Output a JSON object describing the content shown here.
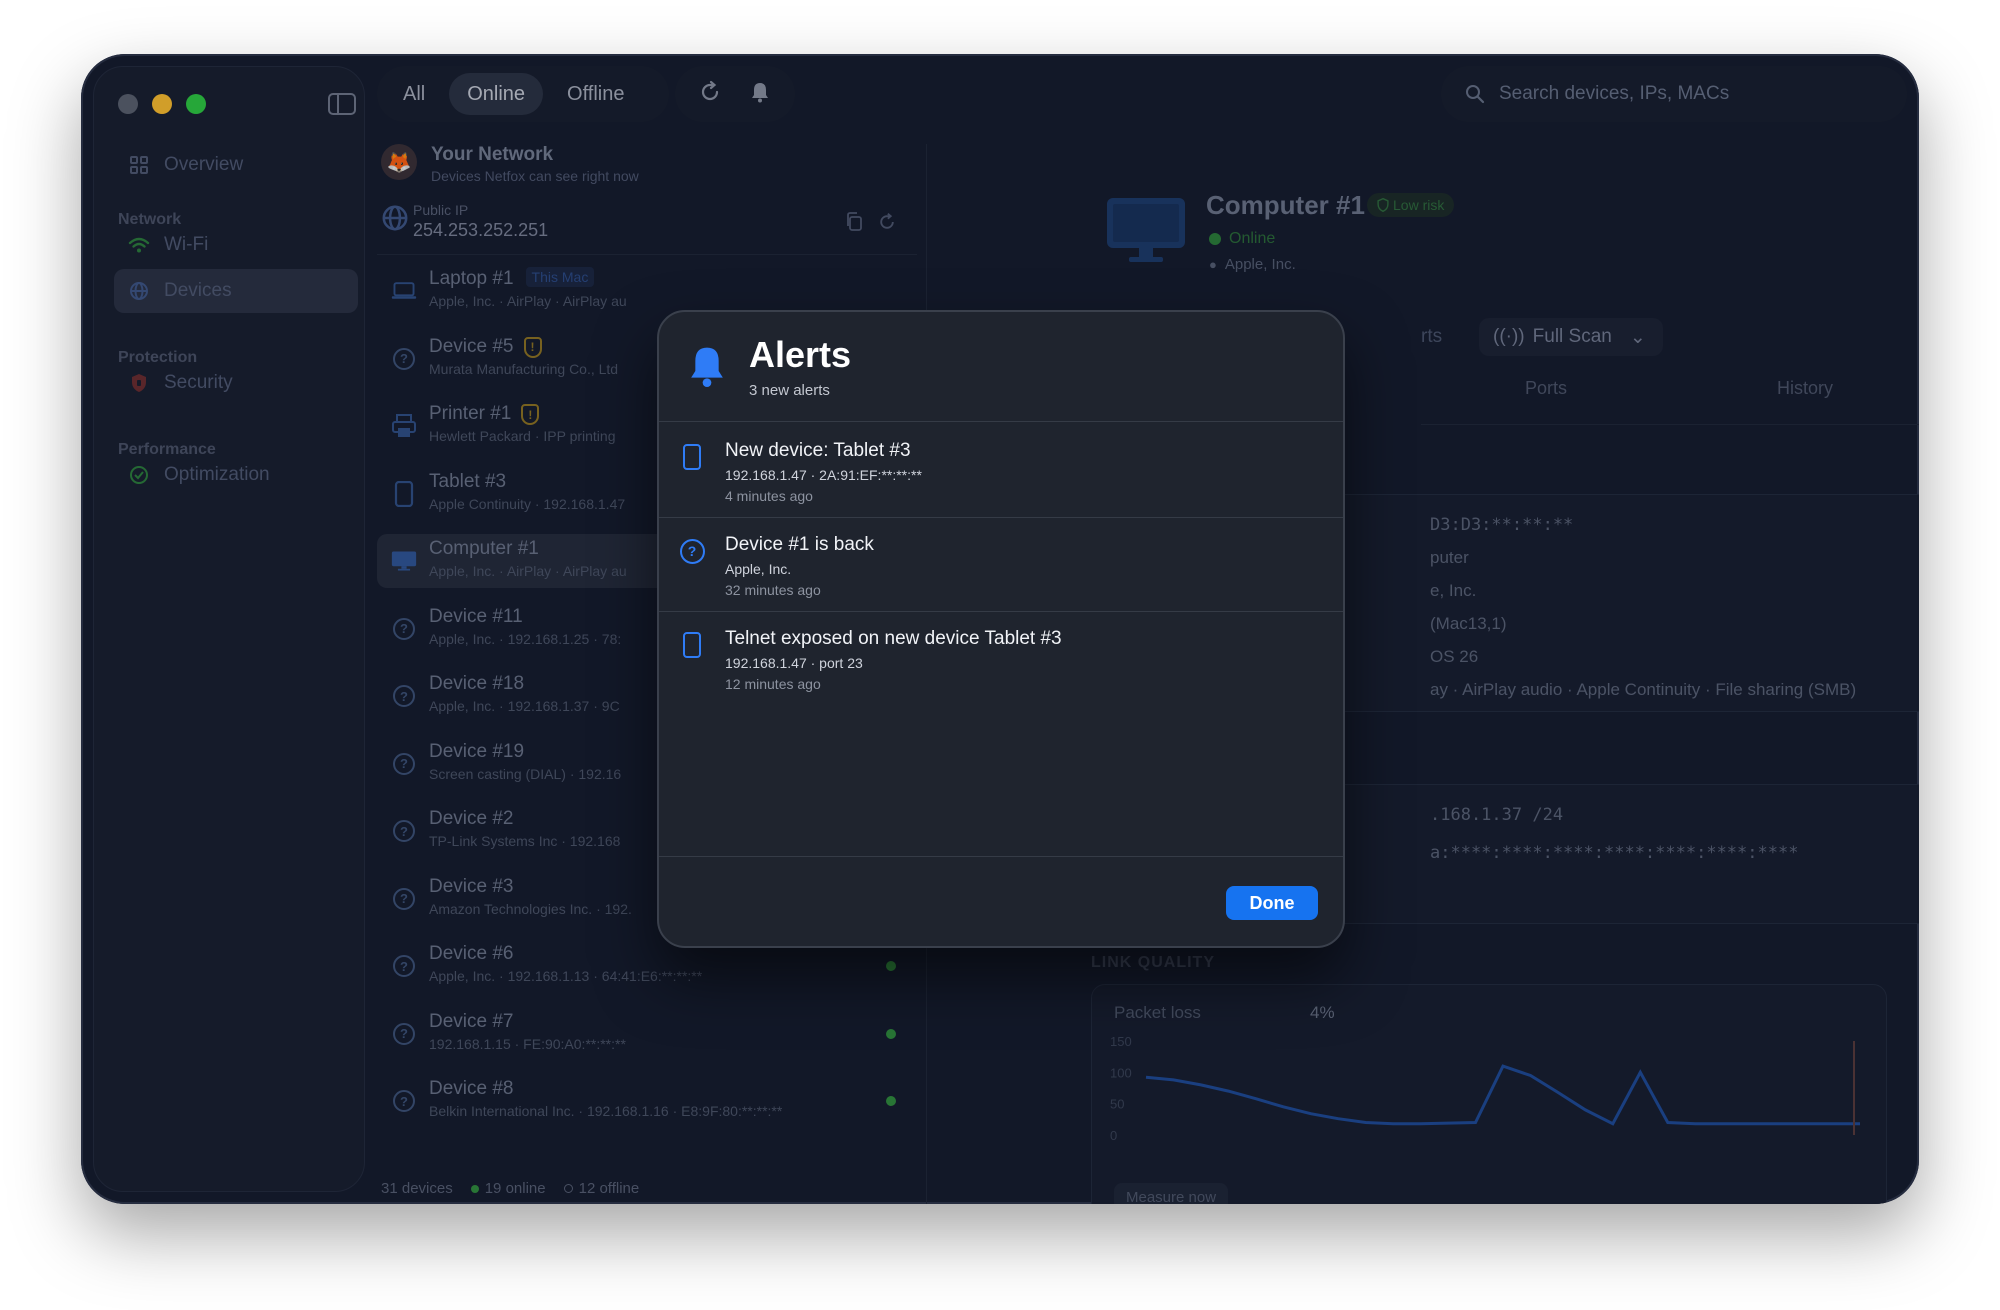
{
  "window": {
    "traffic_colors": [
      "#5a606d",
      "#fdbd2c",
      "#2dc840"
    ]
  },
  "sidebar": {
    "overview": "Overview",
    "sections": [
      {
        "title": "Network",
        "items": [
          {
            "label": "Wi-Fi",
            "icon": "wifi-icon"
          },
          {
            "label": "Devices",
            "icon": "globe-icon",
            "active": true
          }
        ]
      },
      {
        "title": "Protection",
        "items": [
          {
            "label": "Security",
            "icon": "shield-icon"
          }
        ]
      },
      {
        "title": "Performance",
        "items": [
          {
            "label": "Optimization",
            "icon": "gauge-icon"
          }
        ]
      }
    ]
  },
  "toolbar": {
    "filters": [
      "All",
      "Online",
      "Offline"
    ],
    "active_filter": "Online",
    "search_placeholder": "Search devices, IPs, MACs"
  },
  "network": {
    "title": "Your Network",
    "subtitle": "Devices Netfox can see right now",
    "public_ip_label": "Public IP",
    "public_ip": "254.253.252.251"
  },
  "devices": [
    {
      "name": "Laptop #1",
      "tag": "This Mac",
      "sub": "Apple, Inc. · AirPlay · AirPlay au",
      "icon": "laptop"
    },
    {
      "name": "Device #5",
      "warn": true,
      "sub": "Murata Manufacturing Co., Ltd",
      "icon": "question"
    },
    {
      "name": "Printer #1",
      "warn": true,
      "sub": "Hewlett Packard · IPP printing",
      "icon": "printer"
    },
    {
      "name": "Tablet #3",
      "sub": "Apple Continuity · 192.168.1.47",
      "icon": "tablet"
    },
    {
      "name": "Computer #1",
      "sub": "Apple, Inc. · AirPlay · AirPlay au",
      "icon": "computer",
      "active": true
    },
    {
      "name": "Device #11",
      "sub": "Apple, Inc. · 192.168.1.25 · 78:",
      "icon": "question"
    },
    {
      "name": "Device #18",
      "sub": "Apple, Inc. · 192.168.1.37 · 9C",
      "icon": "question"
    },
    {
      "name": "Device #19",
      "sub": "Screen casting (DIAL) · 192.16",
      "icon": "question"
    },
    {
      "name": "Device #2",
      "sub": "TP-Link Systems Inc · 192.168",
      "icon": "question"
    },
    {
      "name": "Device #3",
      "sub": "Amazon Technologies Inc. · 192.",
      "icon": "question"
    },
    {
      "name": "Device #6",
      "sub": "Apple, Inc. · 192.168.1.13 · 64:41:E6:**:**:**",
      "icon": "question",
      "online": true
    },
    {
      "name": "Device #7",
      "sub": "192.168.1.15 · FE:90:A0:**:**:**",
      "icon": "question",
      "online": true
    },
    {
      "name": "Device #8",
      "sub": "Belkin International Inc. · 192.168.1.16 · E8:9F:80:**:**:**",
      "icon": "question",
      "online": true
    }
  ],
  "footer": {
    "total": "31 devices",
    "online": "19 online",
    "offline": "12 offline"
  },
  "detail": {
    "name": "Computer #1",
    "risk": "Low risk",
    "status": "Online",
    "vendor": "Apple, Inc.",
    "actions_partial": "rts",
    "full_scan": "Full Scan",
    "tabs": [
      "Ports",
      "History"
    ],
    "info_lines": [
      "D3:D3:**:**:**",
      "puter",
      "e, Inc.",
      "(Mac13,1)",
      "OS 26",
      "ay · AirPlay audio · Apple Continuity · File sharing (SMB)"
    ],
    "ip_lines": [
      ".168.1.37 /24",
      "a:****:****:****:****:****:****:****"
    ],
    "link_quality_title": "LINK QUALITY",
    "packet_loss_label": "Packet loss",
    "packet_loss_value": "4%",
    "y_ticks": [
      "150",
      "100",
      "50",
      "0"
    ],
    "measure_now": "Measure now"
  },
  "chart_data": {
    "type": "line",
    "title": "",
    "ylim": [
      0,
      150
    ],
    "y_ticks": [
      150,
      100,
      50,
      0
    ],
    "series": [
      {
        "values": [
          92,
          88,
          80,
          70,
          58,
          45,
          34,
          26,
          20,
          18,
          18,
          19,
          20,
          110,
          95,
          68,
          40,
          18,
          100,
          20,
          18,
          18,
          18,
          18,
          18,
          18,
          18
        ]
      }
    ]
  },
  "alerts": {
    "title": "Alerts",
    "subtitle": "3 new alerts",
    "items": [
      {
        "title": "New device: Tablet #3",
        "sub": "192.168.1.47 · 2A:91:EF:**:**:**",
        "time": "4 minutes ago",
        "icon": "tablet"
      },
      {
        "title": "Device #1 is back",
        "sub": "Apple, Inc.",
        "time": "32 minutes ago",
        "icon": "question"
      },
      {
        "title": "Telnet exposed on new device Tablet #3",
        "sub": "192.168.1.47 · port 23",
        "time": "12 minutes ago",
        "icon": "tablet"
      }
    ],
    "done": "Done"
  }
}
